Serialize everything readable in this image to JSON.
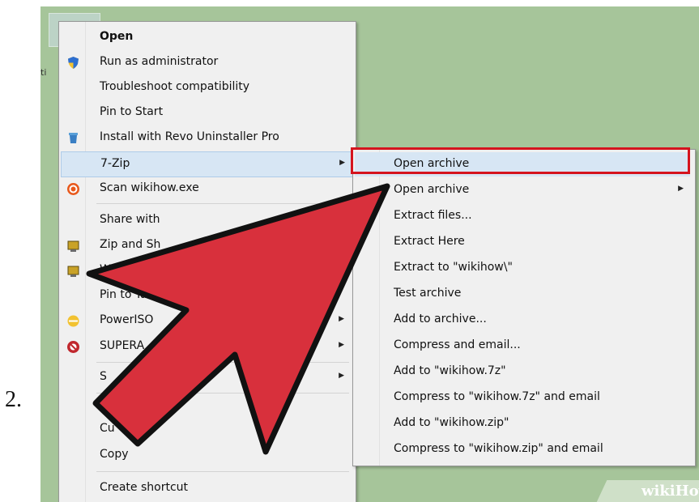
{
  "step_number": "2.",
  "desktop": {
    "icon_label": "ti"
  },
  "context_menu": {
    "items": [
      {
        "label": "Open",
        "icon": "none"
      },
      {
        "label": "Run as administrator",
        "icon": "shield-icon"
      },
      {
        "label": "Troubleshoot compatibility",
        "icon": "none"
      },
      {
        "label": "Pin to Start",
        "icon": "none"
      },
      {
        "label": "Install with Revo Uninstaller Pro",
        "icon": "revo-uninstaller-icon"
      },
      {
        "label": "7-Zip",
        "icon": "none",
        "has_submenu": true
      },
      {
        "label": "Scan wikihow.exe",
        "icon": "antivirus-icon"
      },
      {
        "label": "Share with",
        "icon": "none"
      },
      {
        "label": "Zip and Sh",
        "icon": "winzip-icon"
      },
      {
        "label": "W",
        "icon": "winzip-icon"
      },
      {
        "label": "Pin to Tas",
        "icon": "none"
      },
      {
        "label": "PowerISO",
        "icon": "poweriso-icon",
        "has_submenu": true
      },
      {
        "label": "SUPERA",
        "icon": "superantispyware-icon",
        "has_submenu": true
      },
      {
        "label": "S",
        "icon": "none",
        "has_submenu": true
      },
      {
        "label": "Cu",
        "icon": "none"
      },
      {
        "label": "Copy",
        "icon": "none"
      },
      {
        "label": "Create shortcut",
        "icon": "none"
      }
    ]
  },
  "submenu": {
    "items": [
      {
        "label": "Open archive"
      },
      {
        "label": "Open archive",
        "has_submenu": true
      },
      {
        "label": "Extract files..."
      },
      {
        "label": "Extract Here"
      },
      {
        "label": "Extract to \"wikihow\\\""
      },
      {
        "label": "Test archive"
      },
      {
        "label": "Add to archive..."
      },
      {
        "label": "Compress and email..."
      },
      {
        "label": "Add to \"wikihow.7z\""
      },
      {
        "label": "Compress to \"wikihow.7z\" and email"
      },
      {
        "label": "Add to \"wikihow.zip\""
      },
      {
        "label": "Compress to \"wikihow.zip\" and email"
      }
    ]
  },
  "watermark": {
    "part1": "wiki",
    "part2": "How"
  },
  "colors": {
    "highlight": "#d5141e",
    "arrow_fill": "#d8303c",
    "background": "#a6c59a",
    "menu_highlight": "#d7e6f4"
  }
}
